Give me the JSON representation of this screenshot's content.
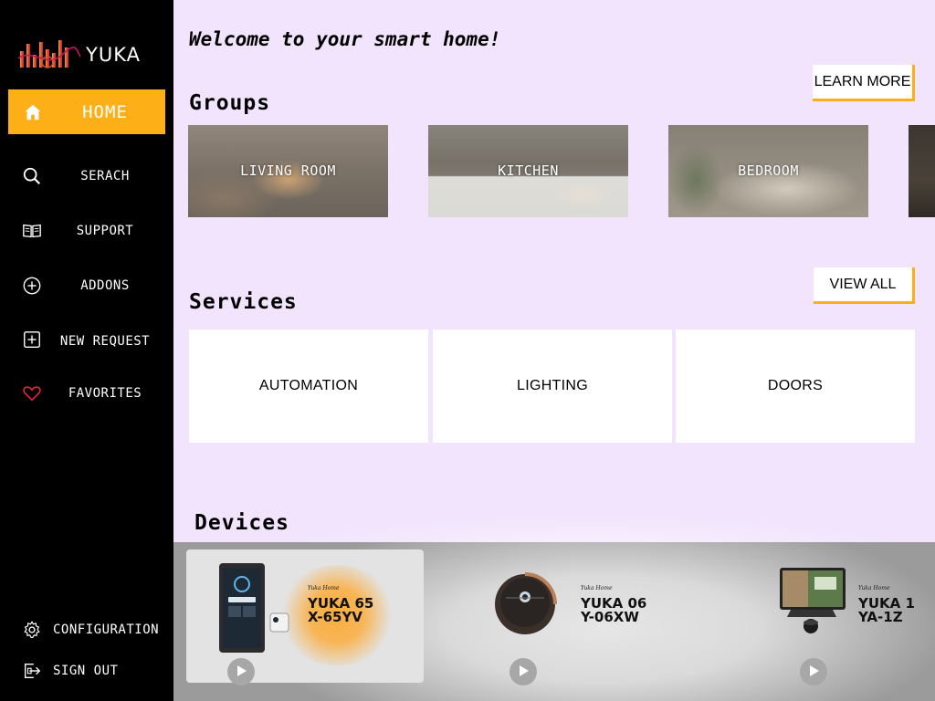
{
  "brand": {
    "name": "YUKA"
  },
  "sidebar": {
    "home": {
      "label": "HOME",
      "icon": "home-icon"
    },
    "items": [
      {
        "label": "SERACH",
        "icon": "search-icon"
      },
      {
        "label": "SUPPORT",
        "icon": "book-icon"
      },
      {
        "label": "ADDONS",
        "icon": "plus-circle-icon"
      },
      {
        "label": "NEW REQUEST",
        "icon": "plus-square-icon"
      },
      {
        "label": "FAVORITES",
        "icon": "heart-icon"
      }
    ],
    "bottom": [
      {
        "label": "CONFIGURATION",
        "icon": "gear-icon"
      },
      {
        "label": "SIGN OUT",
        "icon": "sign-out-icon"
      }
    ]
  },
  "main": {
    "welcome": "Welcome to your smart home!",
    "groups": {
      "title": "Groups",
      "cta": "LEARN MORE",
      "items": [
        {
          "label": "LIVING ROOM"
        },
        {
          "label": "KITCHEN"
        },
        {
          "label": "BEDROOM"
        },
        {
          "label": ""
        }
      ]
    },
    "services": {
      "title": "Services",
      "cta": "VIEW ALL",
      "items": [
        {
          "label": "AUTOMATION"
        },
        {
          "label": "LIGHTING"
        },
        {
          "label": "DOORS"
        }
      ]
    },
    "devices": {
      "title": "Devices",
      "items": [
        {
          "brand": "Yuka Home",
          "line1": "YUKA 65",
          "line2": "X-65YV"
        },
        {
          "brand": "Yuka Home",
          "line1": "YUKA 06",
          "line2": "Y-06XW"
        },
        {
          "brand": "Yuka Home",
          "line1": "YUKA 1",
          "line2": "YA-1Z"
        }
      ]
    }
  },
  "colors": {
    "accent": "#fdaf17",
    "background": "#f1e4fc",
    "sidebar": "#000000",
    "favorite": "#e0242f"
  }
}
